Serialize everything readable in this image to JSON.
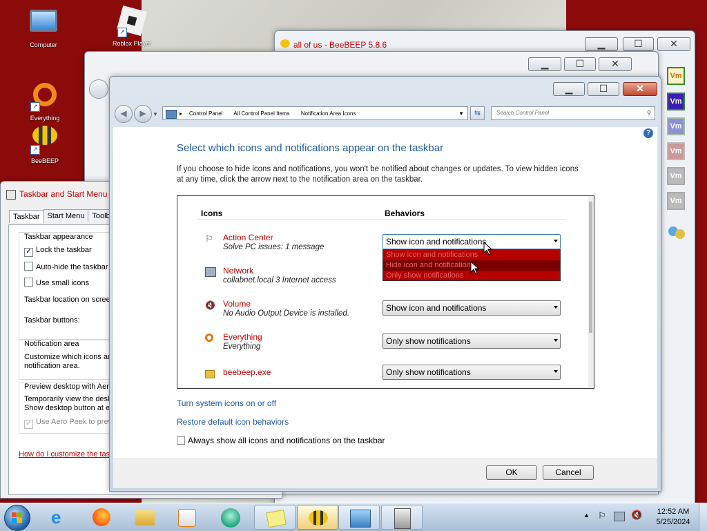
{
  "desktop": {
    "icons": [
      {
        "label": "Computer"
      },
      {
        "label": "Roblox Player"
      },
      {
        "label": "Everything"
      },
      {
        "label": "BeeBEEP"
      }
    ]
  },
  "beebeep_window": {
    "title": "all of us - BeeBEEP 5.8.6"
  },
  "taskbar_props": {
    "title": "Taskbar and Start Menu P",
    "tabs": [
      "Taskbar",
      "Start Menu",
      "Toolb"
    ],
    "appearance_label": "Taskbar appearance",
    "lock": "Lock the taskbar",
    "autohide": "Auto-hide the taskbar",
    "small_icons": "Use small icons",
    "location": "Taskbar location on screen",
    "buttons": "Taskbar buttons:",
    "notification_area": "Notification area",
    "customize": "Customize which icons and",
    "customize2": "notification area.",
    "preview": "Preview desktop with Aero",
    "temp_view": "Temporarily view the desk",
    "show_desktop": "Show desktop button at e",
    "aero_peek": "Use Aero Peek to previ",
    "howto": "How do I customize the task"
  },
  "main": {
    "breadcrumb": [
      "Control Panel",
      "All Control Panel Items",
      "Notification Area Icons"
    ],
    "search_placeholder": "Search Control Panel",
    "heading": "Select which icons and notifications appear on the taskbar",
    "description": "If you choose to hide icons and notifications, you won't be notified about changes or updates. To view hidden icons at any time, click the arrow next to the notification area on the taskbar.",
    "col_icons": "Icons",
    "col_behaviors": "Behaviors",
    "items": [
      {
        "name": "Action Center",
        "sub": "Solve PC issues: 1 message",
        "behavior": "Show icon and notifications"
      },
      {
        "name": "Network",
        "sub": "collabnet.local  3 Internet access",
        "behavior": ""
      },
      {
        "name": "Volume",
        "sub": "No Audio Output Device is installed.",
        "behavior": "Show icon and notifications"
      },
      {
        "name": "Everything",
        "sub": "Everything",
        "behavior": "Only show notifications"
      },
      {
        "name": "beebeep.exe",
        "sub": "",
        "behavior": "Only show notifications"
      }
    ],
    "dropdown_options": [
      "Show icon and notifications",
      "Hide icon and notifications",
      "Only show notifications"
    ],
    "link_system_icons": "Turn system icons on or off",
    "link_restore": "Restore default icon behaviors",
    "always_show": "Always show all icons and notifications on the taskbar",
    "ok": "OK",
    "cancel": "Cancel"
  },
  "vm_label": "Vm",
  "taskbar": {
    "time": "12:52 AM",
    "date": "5/25/2024"
  }
}
